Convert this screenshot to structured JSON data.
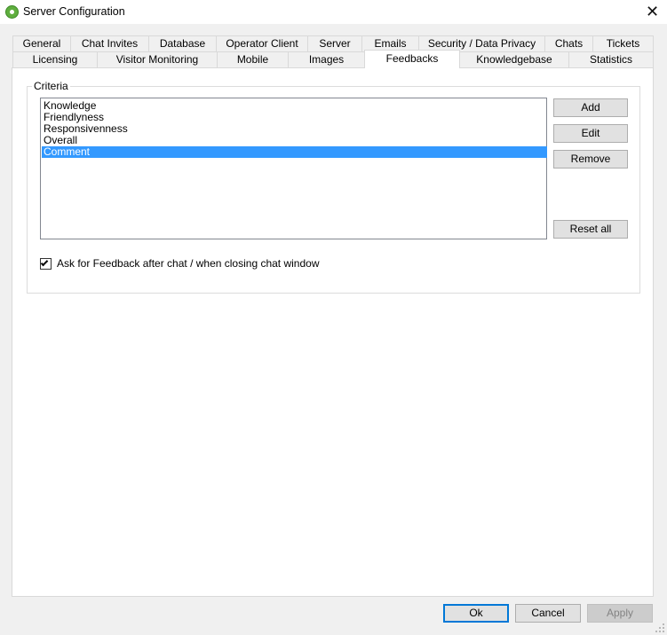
{
  "window": {
    "title": "Server Configuration",
    "close_glyph": "✕",
    "icon": "app-gear-icon"
  },
  "tabs": {
    "row1": [
      "General",
      "Chat Invites",
      "Database",
      "Operator Client",
      "Server",
      "Emails",
      "Security / Data Privacy",
      "Chats",
      "Tickets"
    ],
    "row2": [
      "Licensing",
      "Visitor Monitoring",
      "Mobile",
      "Images",
      "Feedbacks",
      "Knowledgebase",
      "Statistics"
    ],
    "active": "Feedbacks"
  },
  "criteria": {
    "group_label": "Criteria",
    "items": [
      "Knowledge",
      "Friendlyness",
      "Responsivenness",
      "Overall",
      "Comment"
    ],
    "selected_index": 4,
    "add_label": "Add",
    "edit_label": "Edit",
    "remove_label": "Remove",
    "reset_all_label": "Reset all"
  },
  "ask_feedback": {
    "label": "Ask for Feedback after chat / when closing chat window",
    "checked": true
  },
  "footer": {
    "ok_label": "Ok",
    "cancel_label": "Cancel",
    "apply_label": "Apply"
  },
  "colors": {
    "selection": "#3399ff",
    "default_button_border": "#0078d7",
    "app_icon": "#5fae3e"
  }
}
